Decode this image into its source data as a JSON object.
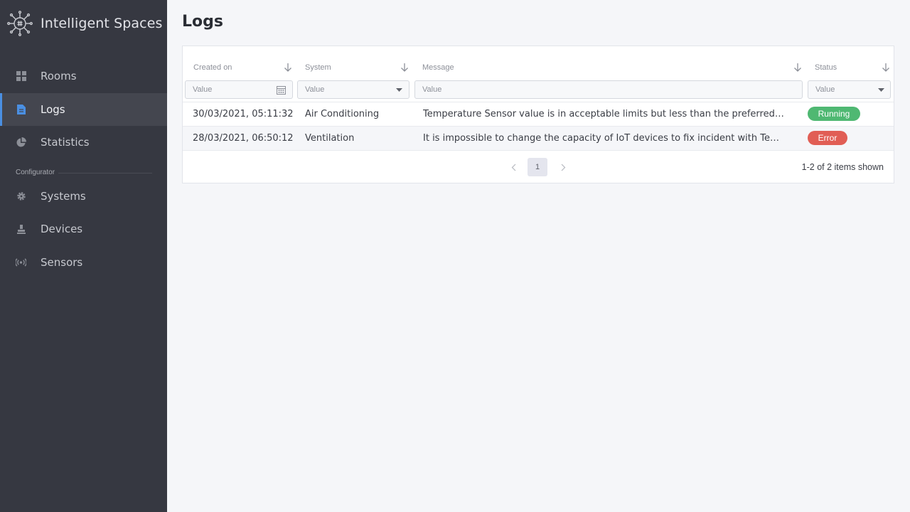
{
  "app": {
    "title": "Intelligent Spaces",
    "icon": "circuit-logo-icon"
  },
  "sidebar": {
    "items": [
      {
        "label": "Rooms",
        "icon": "grid-icon"
      },
      {
        "label": "Logs",
        "icon": "document-icon",
        "active": true
      },
      {
        "label": "Statistics",
        "icon": "pie-chart-icon"
      }
    ],
    "section_label": "Configurator",
    "config_items": [
      {
        "label": "Systems",
        "icon": "gear-icon"
      },
      {
        "label": "Devices",
        "icon": "device-icon"
      },
      {
        "label": "Sensors",
        "icon": "sensor-icon"
      }
    ]
  },
  "page": {
    "title": "Logs"
  },
  "table": {
    "columns": [
      "Created on",
      "System",
      "Message",
      "Status"
    ],
    "filters": {
      "created_placeholder": "Value",
      "system_value": "Value",
      "message_placeholder": "Value",
      "status_value": "Value"
    },
    "rows": [
      {
        "created": "30/03/2021, 05:11:32",
        "system": "Air Conditioning",
        "message": "Temperature Sensor value is in acceptable limits but less than the preferred value ...",
        "status": "Running"
      },
      {
        "created": "28/03/2021, 06:50:12",
        "system": "Ventilation",
        "message": "It is impossible to change the capacity of IoT devices to fix incident with Temperatu ...",
        "status": "Error"
      }
    ],
    "status_colors": {
      "Running": "#4fb872",
      "Error": "#e15e55"
    },
    "pager": {
      "current_page": "1",
      "items_shown": "1-2  of 2 items shown"
    }
  },
  "colors": {
    "sidebar_bg": "#363841",
    "accent": "#4a8fe2"
  }
}
